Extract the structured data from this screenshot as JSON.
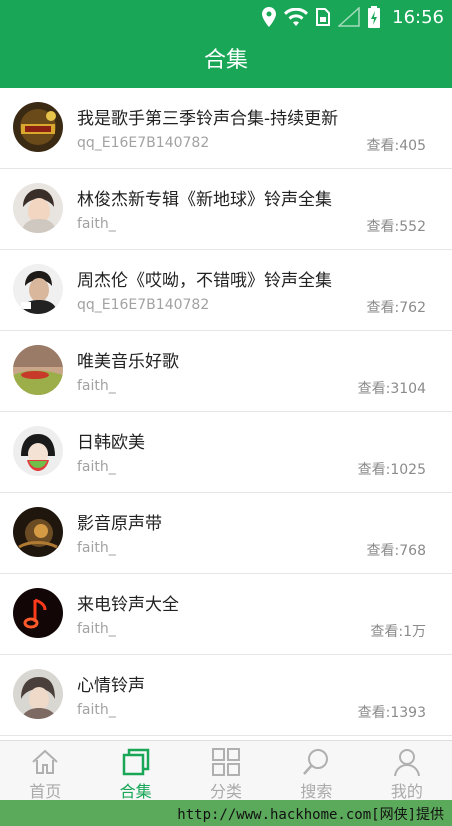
{
  "status_bar": {
    "time": "16:56",
    "icons": [
      "location-icon",
      "wifi-icon",
      "sim-icon",
      "signal-icon",
      "battery-icon"
    ]
  },
  "header": {
    "title": "合集"
  },
  "items": [
    {
      "title": "我是歌手第三季铃声合集-持续更新",
      "user": "qq_E16E7B140782",
      "views": "查看:405"
    },
    {
      "title": "林俊杰新专辑《新地球》铃声全集",
      "user": "faith_",
      "views": "查看:552"
    },
    {
      "title": "周杰伦《哎呦，不错哦》铃声全集",
      "user": "qq_E16E7B140782",
      "views": "查看:762"
    },
    {
      "title": "唯美音乐好歌",
      "user": "faith_",
      "views": "查看:3104"
    },
    {
      "title": "日韩欧美",
      "user": "faith_",
      "views": "查看:1025"
    },
    {
      "title": "影音原声带",
      "user": "faith_",
      "views": "查看:768"
    },
    {
      "title": "来电铃声大全",
      "user": "faith_",
      "views": "查看:1万"
    },
    {
      "title": "心情铃声",
      "user": "faith_",
      "views": "查看:1393"
    }
  ],
  "tabs": [
    {
      "label": "首页",
      "icon": "home-icon",
      "active": false
    },
    {
      "label": "合集",
      "icon": "collection-icon",
      "active": true
    },
    {
      "label": "分类",
      "icon": "grid-icon",
      "active": false
    },
    {
      "label": "搜索",
      "icon": "search-icon",
      "active": false
    },
    {
      "label": "我的",
      "icon": "user-icon",
      "active": false
    }
  ],
  "footer": {
    "text": "http://www.hackhome.com[网侠]提供"
  },
  "colors": {
    "brand": "#19a757",
    "footer": "#5ba95a",
    "inactive_tab": "#aaaaaa"
  }
}
